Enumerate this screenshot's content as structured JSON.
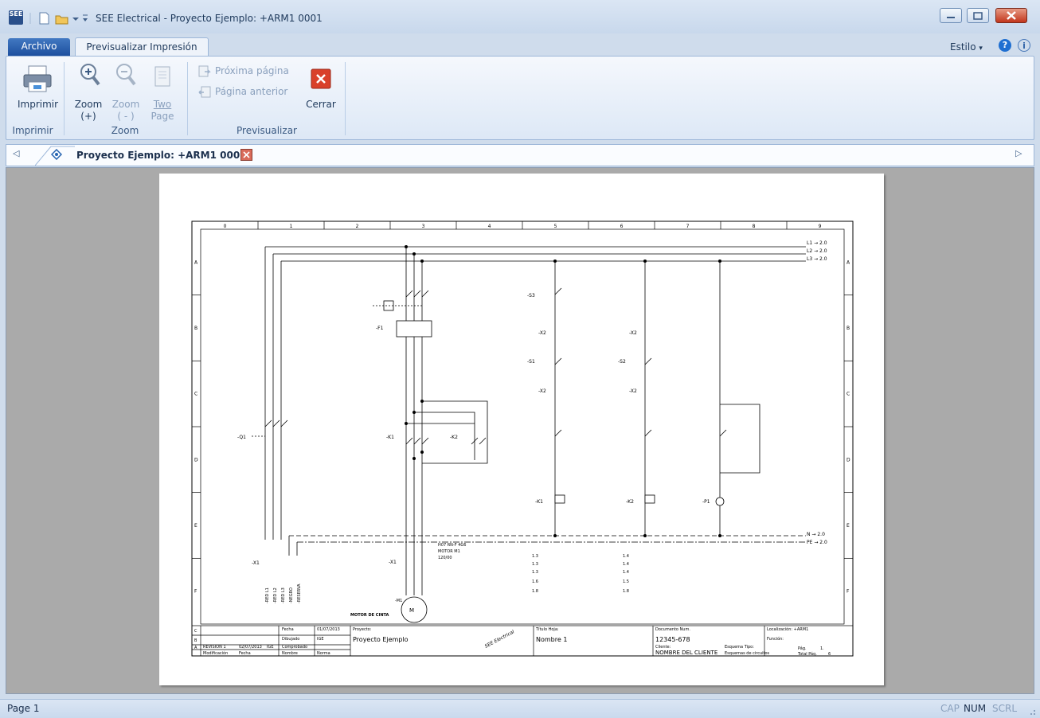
{
  "window": {
    "title": "SEE Electrical - Proyecto Ejemplo: +ARM1 0001",
    "app_icon_text": "SEE"
  },
  "tabs": {
    "archivo": "Archivo",
    "active": "Previsualizar Impresión"
  },
  "top_right": {
    "estilo": "Estilo"
  },
  "ribbon": {
    "imprimir": {
      "button": "Imprimir",
      "group": "Imprimir"
    },
    "zoom": {
      "zoom_in_line1": "Zoom",
      "zoom_in_line2": "(+)",
      "zoom_out_line1": "Zoom",
      "zoom_out_line2": "( - )",
      "two_line1": "Two",
      "two_line2": "Page",
      "group": "Zoom"
    },
    "previsualizar": {
      "next": "Próxima página",
      "prev": "Página anterior",
      "close": "Cerrar",
      "group": "Previsualizar"
    }
  },
  "doc_tab": {
    "label": "Proyecto Ejemplo: +ARM1 0001"
  },
  "drawing": {
    "columns": [
      "0",
      "1",
      "2",
      "3",
      "4",
      "5",
      "6",
      "7",
      "8",
      "9"
    ],
    "rows": [
      "A",
      "B",
      "C",
      "D",
      "E",
      "F"
    ],
    "phases": [
      "L1",
      "L2",
      "L3"
    ],
    "phase_ref": "2.0",
    "n_label": "N",
    "pe_label": "PE",
    "q1": "-Q1",
    "f1": "-F1",
    "k1": "-K1",
    "k2": "-K2",
    "m1": "-M1",
    "x1": "-X1",
    "s3": "-S3",
    "s1": "-S1",
    "s2": "-S2",
    "x2": "-X2",
    "p1": "-P1",
    "motor_label": "MOTOR DE CINTA",
    "cable_label": "H07 RN-F 4G6",
    "motor_m1": "MOTOR M1",
    "motor_cable_len": "120/00",
    "contact_ref_k1": [
      "1.3",
      "1.3",
      "1.3",
      "1.6",
      "1.8"
    ],
    "contact_ref_k2": [
      "1.4",
      "1.4",
      "1.4",
      "1.5",
      "1.8"
    ],
    "terminals": [
      "-RED L1",
      "-RED L2",
      "-RED L3",
      "-NEGRO",
      "-RESERVA"
    ],
    "title_block": {
      "fecha_label": "Fecha",
      "fecha": "01/07/2013",
      "dibujado_label": "Dibujado",
      "dibujado": "IGE",
      "comprobado_label": "Comprobado",
      "proyecto_label": "Proyecto:",
      "proyecto": "Proyecto Ejemplo",
      "titulo_label": "Título Hoja:",
      "titulo": "Nombre 1",
      "documento_label": "Documento Num.",
      "documento": "12345-678",
      "cliente_label": "Cliente:",
      "cliente": "NOMBRE DEL CLIENTE",
      "localizacion_label": "Localización: +ARM1",
      "funcion_label": "Función:",
      "esquema_label": "Esquema Tipo:",
      "esquema": "Esquemas de circuitos",
      "pag_label": "Pág.",
      "pag": "1.",
      "total_label": "Total Pág.",
      "total": "6",
      "rev": "REVISION 1",
      "rev_date": "02/07/2013",
      "rev_by": "IGE",
      "mod_label": "Modificación",
      "mod_fecha": "Fecha",
      "mod_nombre": "Nombre",
      "mod_norma": "Norma",
      "row_c": "C",
      "row_b": "B",
      "row_a": "A",
      "stamp": "SEE Electrical"
    }
  },
  "status": {
    "left": "Page 1",
    "cap": "CAP",
    "num": "NUM",
    "scrl": "SCRL"
  },
  "colors": {
    "ribbon_blue": "#1e395b",
    "close_red": "#c2361d",
    "workspace_gray": "#aaaaaa"
  }
}
